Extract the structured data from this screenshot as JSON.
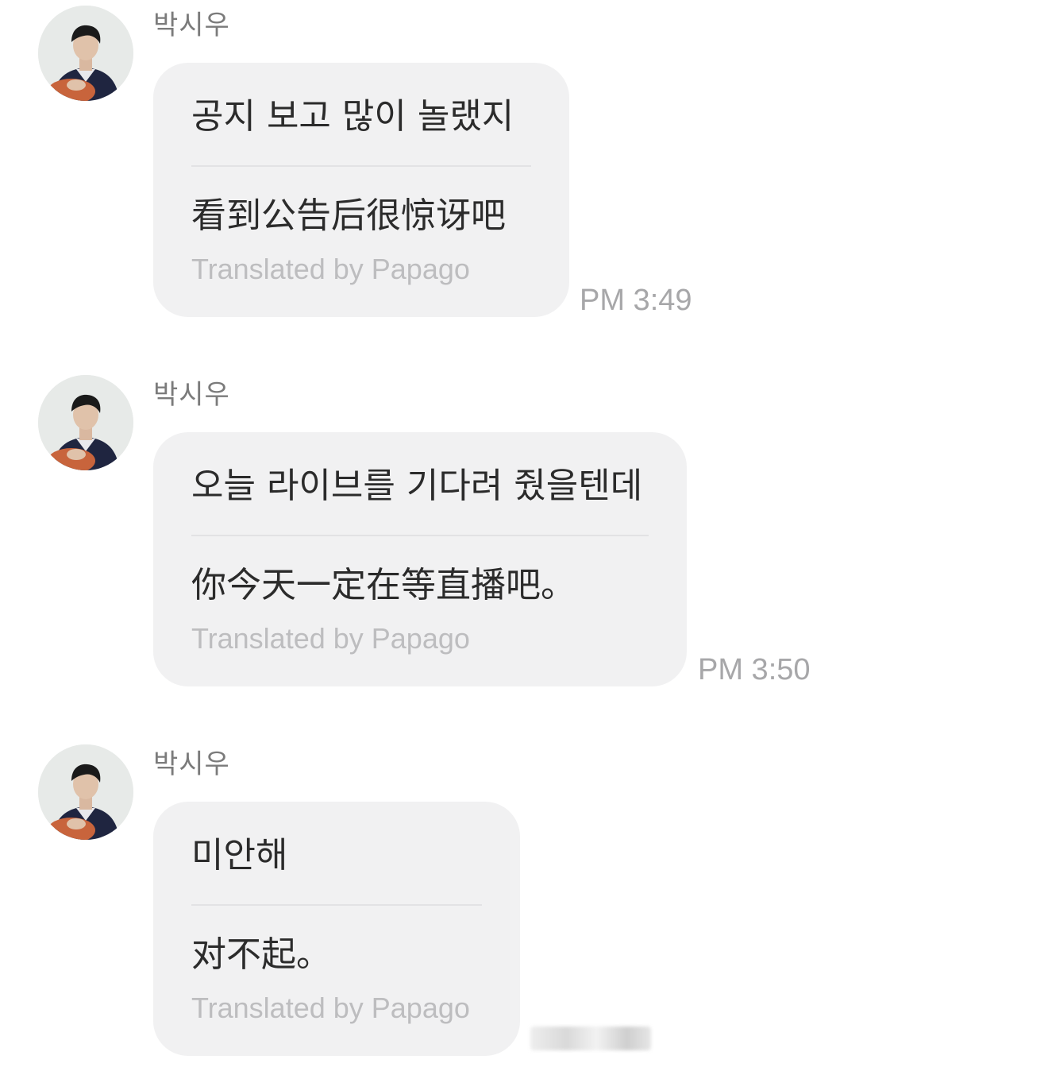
{
  "messages": [
    {
      "sender": "박시우",
      "original_text": "공지 보고 많이 놀랬지",
      "translated_text": "看到公告后很惊讶吧",
      "translator_label": "Translated by Papago",
      "time": "PM 3:49"
    },
    {
      "sender": "박시우",
      "original_text": "오늘 라이브를 기다려 줬을텐데",
      "translated_text": "你今天一定在等直播吧。",
      "translator_label": "Translated by Papago",
      "time": "PM 3:50"
    },
    {
      "sender": "박시우",
      "original_text": "미안해",
      "translated_text": "对不起。",
      "translator_label": "Translated by Papago",
      "time": ""
    }
  ],
  "icons": {
    "avatar": "profile-photo-icon"
  },
  "colors": {
    "bubble_background": "#f1f1f2",
    "sender_text": "#7b7b7b",
    "translator_text": "#bdbdbf",
    "timestamp_text": "#a7a7a9"
  }
}
